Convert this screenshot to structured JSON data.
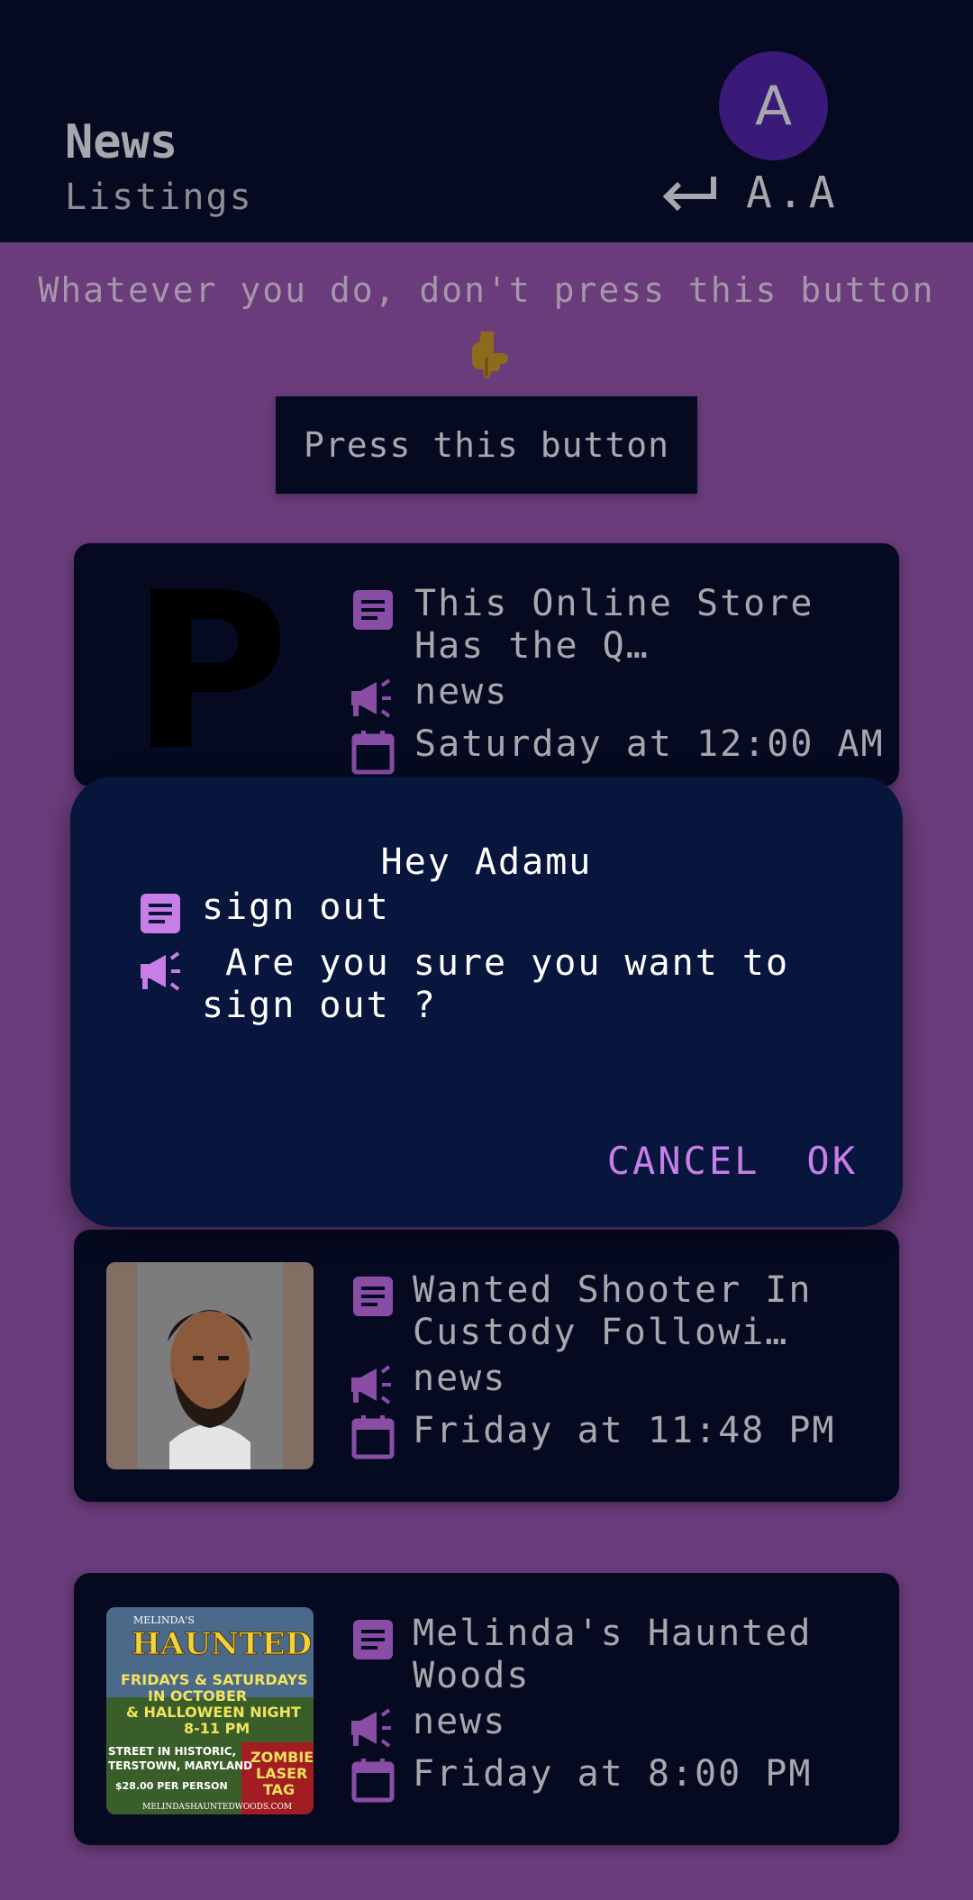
{
  "header": {
    "title": "News",
    "subtitle": "Listings",
    "avatar_letter": "A",
    "initials": "A.A"
  },
  "warning_text": "Whatever you do, don't press this button",
  "press_button_label": "Press this button",
  "cards": [
    {
      "thumb_letter": "P",
      "title": "This Online Store Has the Q…",
      "category": "news",
      "date": "Saturday at 12:00 AM"
    },
    {
      "thumb_image": "mugshot-photo",
      "title": "Wanted Shooter In Custody Followi…",
      "category": "news",
      "date": "Friday at 11:48 PM"
    },
    {
      "thumb_image": "haunted-woods-poster",
      "poster_lines": [
        "MELINDA'S",
        "HAUNTED W",
        "FRIDAYS & SATURDAYS",
        "IN OCTOBER",
        "& HALLOWEEN NIGHT",
        "8-11 PM",
        "STREET IN HISTORIC,",
        "TERSTOWN, MARYLAND",
        "ZOMBIE",
        "LASER",
        "TAG",
        "$28.00 PER PERSON",
        "MELINDASHAUNTEDWOODS.COM"
      ],
      "title": "Melinda's Haunted Woods",
      "category": "news",
      "date": "Friday at 8:00 PM"
    }
  ],
  "dialog": {
    "greeting": "Hey Adamu",
    "heading": "sign out",
    "message": " Are you sure you want to sign out ?",
    "cancel_label": "CANCEL",
    "ok_label": "OK"
  },
  "colors": {
    "background": "#6a3c7b",
    "header": "#050a20",
    "card": "#050a20",
    "dialog": "#08163e",
    "accent": "#c77ee6",
    "avatar": "#3a1a78"
  },
  "icons": [
    "signout-arrow-icon",
    "pointing-down-icon",
    "article-icon",
    "megaphone-icon",
    "calendar-icon"
  ]
}
